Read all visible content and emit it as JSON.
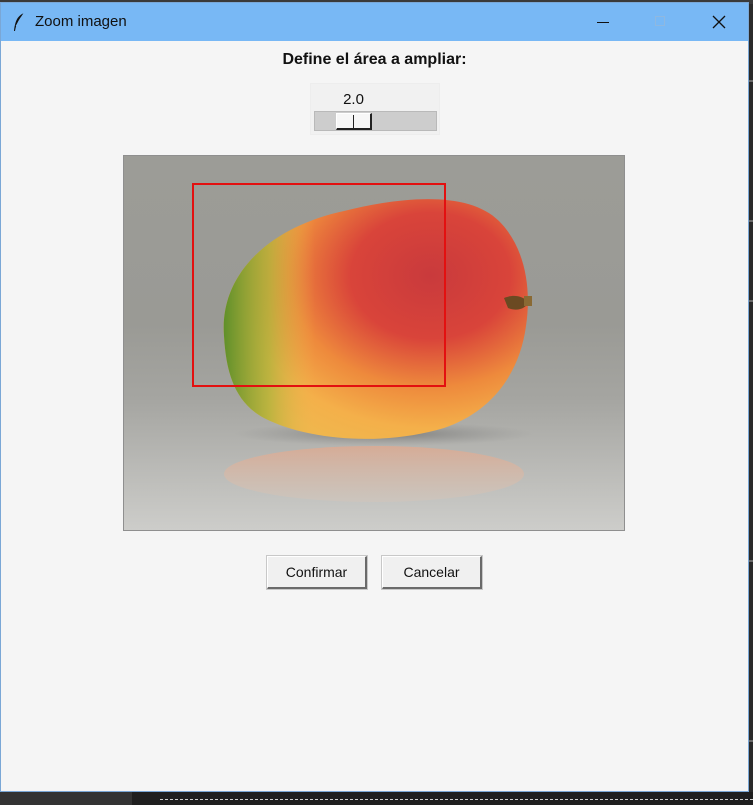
{
  "window": {
    "title": "Zoom imagen",
    "icon": "feather-icon",
    "controls": [
      "minimize-icon",
      "maximize-icon",
      "close-icon"
    ]
  },
  "heading": "Define el área a ampliar:",
  "zoom_scale": {
    "value": "2.0",
    "min": 1.0,
    "max": 5.0
  },
  "image": {
    "subject": "mango",
    "selection_color": "#e31010"
  },
  "buttons": {
    "confirm": "Confirmar",
    "cancel": "Cancelar"
  },
  "colors": {
    "titlebar": "#78b8f5",
    "background": "#f5f5f5"
  }
}
